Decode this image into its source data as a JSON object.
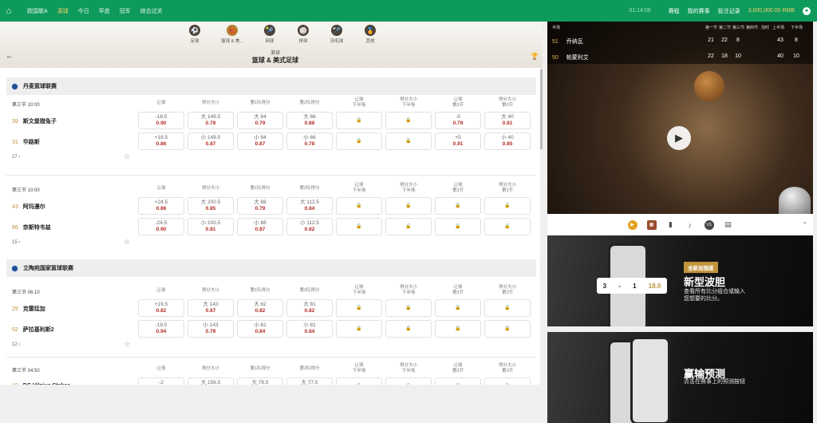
{
  "nav": {
    "items": [
      "欧国联A",
      "滚球",
      "今日",
      "早盘",
      "冠军",
      "综合过关"
    ],
    "clock": "01:14:06",
    "links": [
      "赛程",
      "我的赛事",
      "投注记录"
    ],
    "balance": "3,000,000.00 RMB"
  },
  "sports": [
    {
      "label": "足球",
      "icon": "⚽"
    },
    {
      "label": "篮球 & 美...",
      "icon": "🏀"
    },
    {
      "label": "网球",
      "icon": "🎾"
    },
    {
      "label": "排球",
      "icon": "🏐"
    },
    {
      "label": "羽毛球",
      "icon": "🏸"
    },
    {
      "label": "其他",
      "icon": "🏅"
    }
  ],
  "page": {
    "subtitle": "滚球",
    "title": "篮球 & 美式足球"
  },
  "headers": {
    "c1": "让球",
    "c2": "得分大小",
    "c3": "第1队得分",
    "c4": "第2队得分",
    "c5a": "让球",
    "c5b": "下半场",
    "c6a": "得分大小",
    "c6b": "下半场",
    "c7a": "让球",
    "c7b": "第3节",
    "c8a": "得分大小",
    "c8b": "第3节"
  },
  "leagues": [
    {
      "name": "丹麦篮球联赛"
    },
    {
      "name": "立陶宛国家篮球联赛"
    }
  ],
  "matches": [
    {
      "time": "第三节 10:00",
      "more": "27 ›",
      "teams": [
        {
          "rank": "39",
          "name": "斯文堡猎兔子",
          "o": [
            [
              "-18.5",
              "0.90"
            ],
            [
              "大 149.5",
              "0.79"
            ],
            [
              "大 84",
              "0.79"
            ],
            [
              "大 66",
              "0.88"
            ],
            [
              "-5",
              "0.79"
            ],
            [
              "大 40",
              "0.81"
            ]
          ]
        },
        {
          "rank": "31",
          "name": "华路斯",
          "o": [
            [
              "+18.5",
              "0.86"
            ],
            [
              "小 149.5",
              "0.87"
            ],
            [
              "小 84",
              "0.87"
            ],
            [
              "小 66",
              "0.78"
            ],
            [
              "+5",
              "0.91"
            ],
            [
              "小 40",
              "0.85"
            ]
          ]
        }
      ]
    },
    {
      "time": "第三节 10:00",
      "more": "15 ›",
      "teams": [
        {
          "rank": "43",
          "name": "阿玛遵尔",
          "o": [
            [
              "+24.5",
              "0.86"
            ],
            [
              "大 200.5",
              "0.85"
            ],
            [
              "大 88",
              "0.79"
            ],
            [
              "大 112.5",
              "0.84"
            ]
          ]
        },
        {
          "rank": "66",
          "name": "奈斯特韦兹",
          "o": [
            [
              "-24.5",
              "0.90"
            ],
            [
              "小 200.5",
              "0.81"
            ],
            [
              "小 88",
              "0.87"
            ],
            [
              "小 112.5",
              "0.82"
            ]
          ]
        }
      ]
    },
    {
      "time": "第三节 06:10",
      "more": "12 ›",
      "teams": [
        {
          "rank": "29",
          "name": "克雷廷加",
          "o": [
            [
              "+19.5",
              "0.82"
            ],
            [
              "大 143",
              "0.87"
            ],
            [
              "大 62",
              "0.82"
            ],
            [
              "大 81",
              "0.82"
            ]
          ]
        },
        {
          "rank": "52",
          "name": "萨拉基利斯2",
          "o": [
            [
              "-19.5",
              "0.94"
            ],
            [
              "小 143",
              "0.79"
            ],
            [
              "小 62",
              "0.84"
            ],
            [
              "小 81",
              "0.84"
            ]
          ]
        }
      ]
    },
    {
      "time": "第三节 04:50",
      "teams": [
        {
          "rank": "40",
          "name": "BC Vilnius Stakes",
          "o": [
            [
              "-2",
              ""
            ],
            [
              "大 156.5",
              ""
            ],
            [
              "大 79.5",
              ""
            ],
            [
              "大 77.5",
              ""
            ]
          ]
        }
      ]
    }
  ],
  "scoreboard": {
    "label": "半场",
    "cols": [
      "第一节",
      "第二节",
      "第三节",
      "第四节",
      "加时",
      "上半场",
      "下半场"
    ],
    "teams": [
      {
        "rank": "51",
        "name": "乔纳瓦",
        "s": [
          "21",
          "22",
          "8",
          "43",
          "8"
        ]
      },
      {
        "rank": "50",
        "name": "帕蒙利艾",
        "s": [
          "22",
          "18",
          "10",
          "40",
          "10"
        ]
      }
    ]
  },
  "promo1": {
    "badge": "全新加强版",
    "title": "新型波胆",
    "desc": "查看所有比分组合或输入您想要的比分。",
    "score": [
      "3",
      "-",
      "1",
      "18.0"
    ]
  },
  "promo2": {
    "title": "赢输预测",
    "desc": "点击在赛事上的预测按钮"
  }
}
